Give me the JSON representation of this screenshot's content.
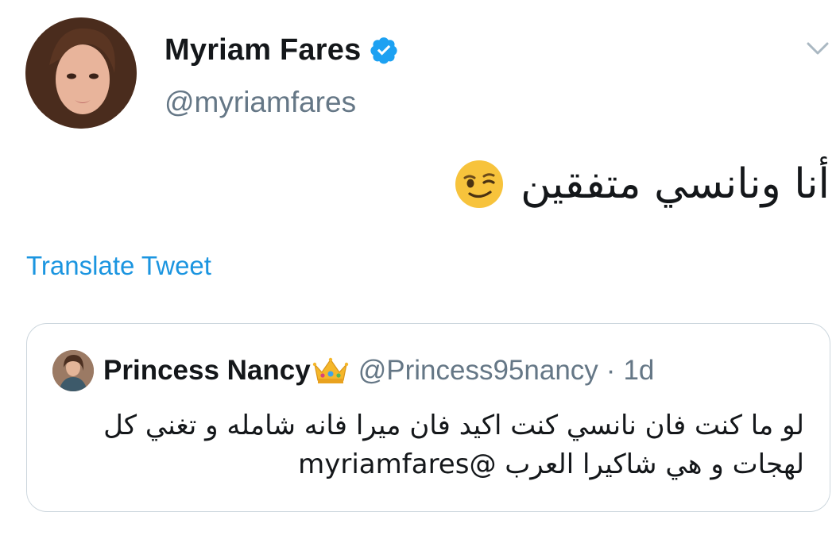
{
  "author": {
    "name": "Myriam Fares",
    "handle": "@myriamfares",
    "avatar_icon": "profile-photo",
    "verified_icon": "verified-badge-icon",
    "verified_color": "#1da1f2"
  },
  "menu": {
    "icon": "chevron-down-icon"
  },
  "tweet": {
    "text": "أنا ونانسي متفقين",
    "emoji": "winking-face-emoji"
  },
  "translate_label": "Translate Tweet",
  "quoted": {
    "name": "Princess Nancy",
    "name_emoji": "crown-emoji",
    "handle": "@Princess95nancy",
    "separator": "·",
    "time": "1d",
    "text_line1": "لو ما كنت فان نانسي كنت اكيد فان ميرا فانه شامله و تغني كل",
    "text_line2": "لهجات و هي شاكيرا العرب",
    "mention": "@myriamfares"
  },
  "colors": {
    "text": "#14171a",
    "secondary": "#657786",
    "link": "#1b95e0",
    "border": "#ccd6dd"
  }
}
